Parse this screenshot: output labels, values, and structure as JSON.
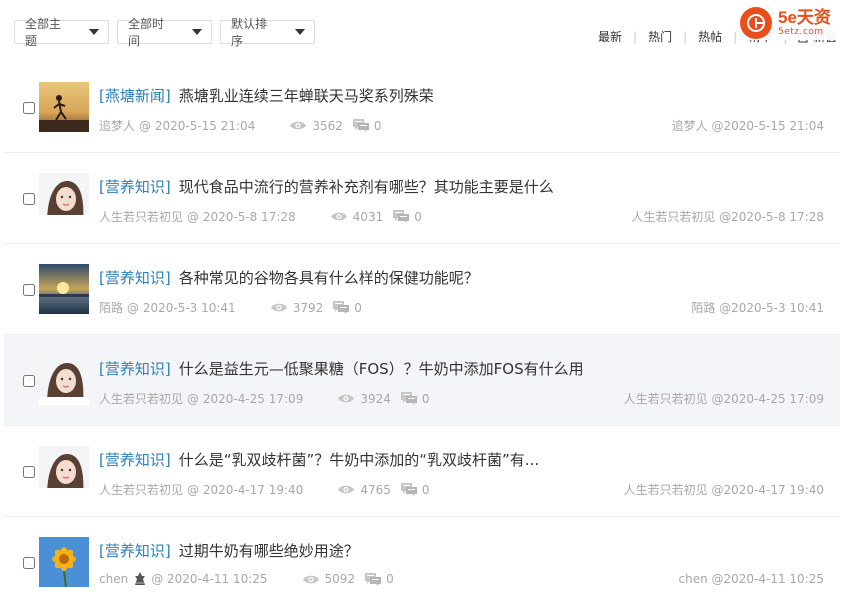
{
  "filters": [
    {
      "label": "全部主题"
    },
    {
      "label": "全部时间"
    },
    {
      "label": "默认排序"
    }
  ],
  "tabs": [
    "最新",
    "热门",
    "热帖",
    "精华",
    "新窗"
  ],
  "logo": {
    "main": "5e天资",
    "sub": "5etz.com"
  },
  "threads": [
    {
      "tag": "[燕塘新闻]",
      "title": "燕塘乳业连续三年蝉联天马奖系列殊荣",
      "author": "追梦人",
      "time": "@ 2020-5-15 21:04",
      "views": "3562",
      "replies": "0",
      "last": "追梦人 @2020-5-15 21:04",
      "thumb": "runner"
    },
    {
      "tag": "[营养知识]",
      "title": "现代食品中流行的营养补充剂有哪些？其功能主要是什么",
      "author": "人生若只若初见",
      "time": "@ 2020-5-8 17:28",
      "views": "4031",
      "replies": "0",
      "last": "人生若只若初见 @2020-5-8 17:28",
      "thumb": "girl"
    },
    {
      "tag": "[营养知识]",
      "title": "各种常见的谷物各具有什么样的保健功能呢？",
      "author": "陌路",
      "time": "@ 2020-5-3 10:41",
      "views": "3792",
      "replies": "0",
      "last": "陌路 @2020-5-3 10:41",
      "thumb": "sunset"
    },
    {
      "tag": "[营养知识]",
      "title": "什么是益生元—低聚果糖（FOS）？牛奶中添加FOS有什么用",
      "author": "人生若只若初见",
      "time": "@ 2020-4-25 17:09",
      "views": "3924",
      "replies": "0",
      "last": "人生若只若初见 @2020-4-25 17:09",
      "thumb": "girl"
    },
    {
      "tag": "[营养知识]",
      "title": "什么是“乳双歧杆菌”？牛奶中添加的“乳双歧杆菌”有...",
      "author": "人生若只若初见",
      "time": "@ 2020-4-17 19:40",
      "views": "4765",
      "replies": "0",
      "last": "人生若只若初见 @2020-4-17 19:40",
      "thumb": "girl"
    },
    {
      "tag": "[营养知识]",
      "title": "过期牛奶有哪些绝妙用途？",
      "author": "chen",
      "time": "@ 2020-4-11 10:25",
      "views": "5092",
      "replies": "0",
      "last": "chen @2020-4-11 10:25",
      "thumb": "flower"
    }
  ]
}
